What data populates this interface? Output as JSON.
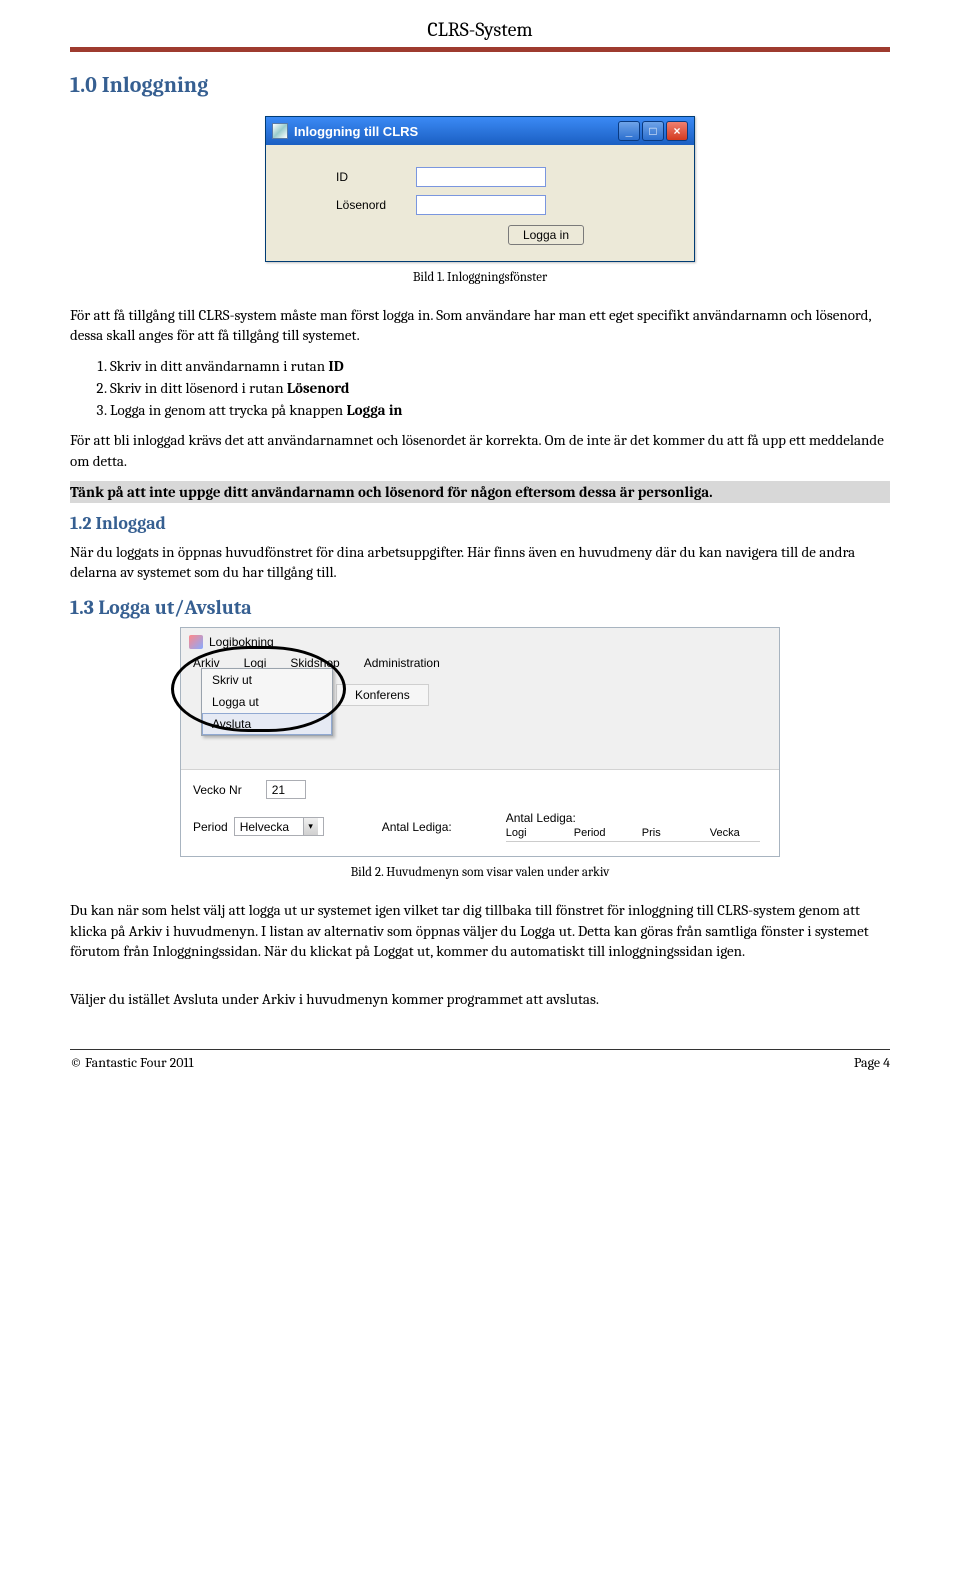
{
  "header": {
    "title": "CLRS-System"
  },
  "section1": {
    "heading": "1.0 Inloggning",
    "figure_caption": "Bild 1. Inloggningsfönster",
    "login_window": {
      "title": "Inloggning till CLRS",
      "label_id": "ID",
      "label_password": "Lösenord",
      "button": "Logga in"
    },
    "para1": "För att få tillgång till CLRS-system måste man först logga in. Som användare har man ett eget specifikt användarnamn och lösenord, dessa skall anges för att få tillgång till systemet.",
    "steps": [
      {
        "text": "Skriv in ditt användarnamn i rutan ",
        "bold": "ID"
      },
      {
        "text": "Skriv in ditt lösenord i rutan ",
        "bold": "Lösenord"
      },
      {
        "text": "Logga in genom att trycka på knappen ",
        "bold": "Logga in"
      }
    ],
    "para2": "För att bli inloggad krävs det att användarnamnet och lösenordet är korrekta. Om de inte är det kommer du att få upp ett meddelande om detta.",
    "highlight": "Tänk på att inte uppge ditt användarnamn och lösenord för någon eftersom dessa är personliga."
  },
  "section12": {
    "heading": "1.2 Inloggad",
    "para": "När du loggats in öppnas huvudfönstret för dina arbetsuppgifter. Här finns även en huvudmeny där du kan navigera till de andra delarna av systemet som du har tillgång till."
  },
  "section13": {
    "heading": "1.3 Logga ut/Avsluta",
    "figure_caption": "Bild 2. Huvudmenyn som visar valen under arkiv",
    "menu": {
      "window_title": "Logibokning",
      "menubar": [
        "Arkiv",
        "Logi",
        "Skidshop",
        "Administration"
      ],
      "dropdown": [
        "Skriv ut",
        "Logga ut",
        "Avsluta"
      ],
      "sub_item": "Konferens",
      "vecko_label": "Vecko Nr",
      "vecko_value": "21",
      "period_label": "Period",
      "period_value": "Helvecka",
      "antal_label": "Antal Lediga:",
      "columns": [
        "Logi",
        "Period",
        "Pris",
        "Vecka"
      ]
    },
    "para1": "Du kan när som helst välj att logga ut ur systemet igen vilket tar dig tillbaka till fönstret för inloggning till CLRS-system genom att klicka på Arkiv i huvudmenyn. I listan av alternativ som öppnas väljer du Logga ut. Detta kan göras från samtliga fönster i systemet förutom från Inloggningssidan. När du klickat på Loggat ut, kommer du automatiskt till inloggningssidan igen.",
    "para2": "Väljer du istället Avsluta under Arkiv i huvudmenyn kommer programmet att avslutas."
  },
  "footer": {
    "left": "© Fantastic Four 2011",
    "right": "Page 4"
  }
}
